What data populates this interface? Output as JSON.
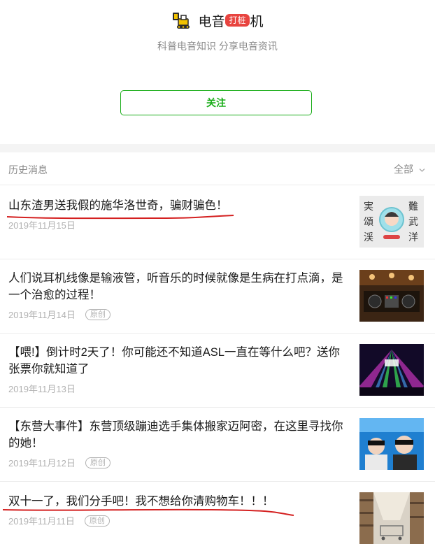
{
  "profile": {
    "name_part1": "电音",
    "badge": "打桩",
    "name_part2": "机",
    "slogan": "科普电音知识 分享电音资讯",
    "follow_label": "关注"
  },
  "history": {
    "title": "历史消息",
    "filter_label": "全部"
  },
  "articles": [
    {
      "title": "山东渣男送我假的施华洛世奇，骗财骗色！",
      "date": "2019年11月15日",
      "tag": ""
    },
    {
      "title": "人们说耳机线像是输液管，听音乐的时候就像是生病在打点滴，是一个治愈的过程！",
      "date": "2019年11月14日",
      "tag": "原创"
    },
    {
      "title": "【喂!】倒计时2天了！你可能还不知道ASL一直在等什么吧？送你张票你就知道了",
      "date": "2019年11月13日",
      "tag": ""
    },
    {
      "title": "【东营大事件】东营顶级蹦迪选手集体搬家迈阿密，在这里寻找你的她！",
      "date": "2019年11月12日",
      "tag": "原创"
    },
    {
      "title": "双十一了，我们分手吧！我不想给你清购物车！！！",
      "date": "2019年11月11日",
      "tag": "原创"
    }
  ],
  "colors": {
    "accent_green": "#1aad19",
    "badge_red": "#e8443f",
    "annotation_red": "#d42020"
  }
}
